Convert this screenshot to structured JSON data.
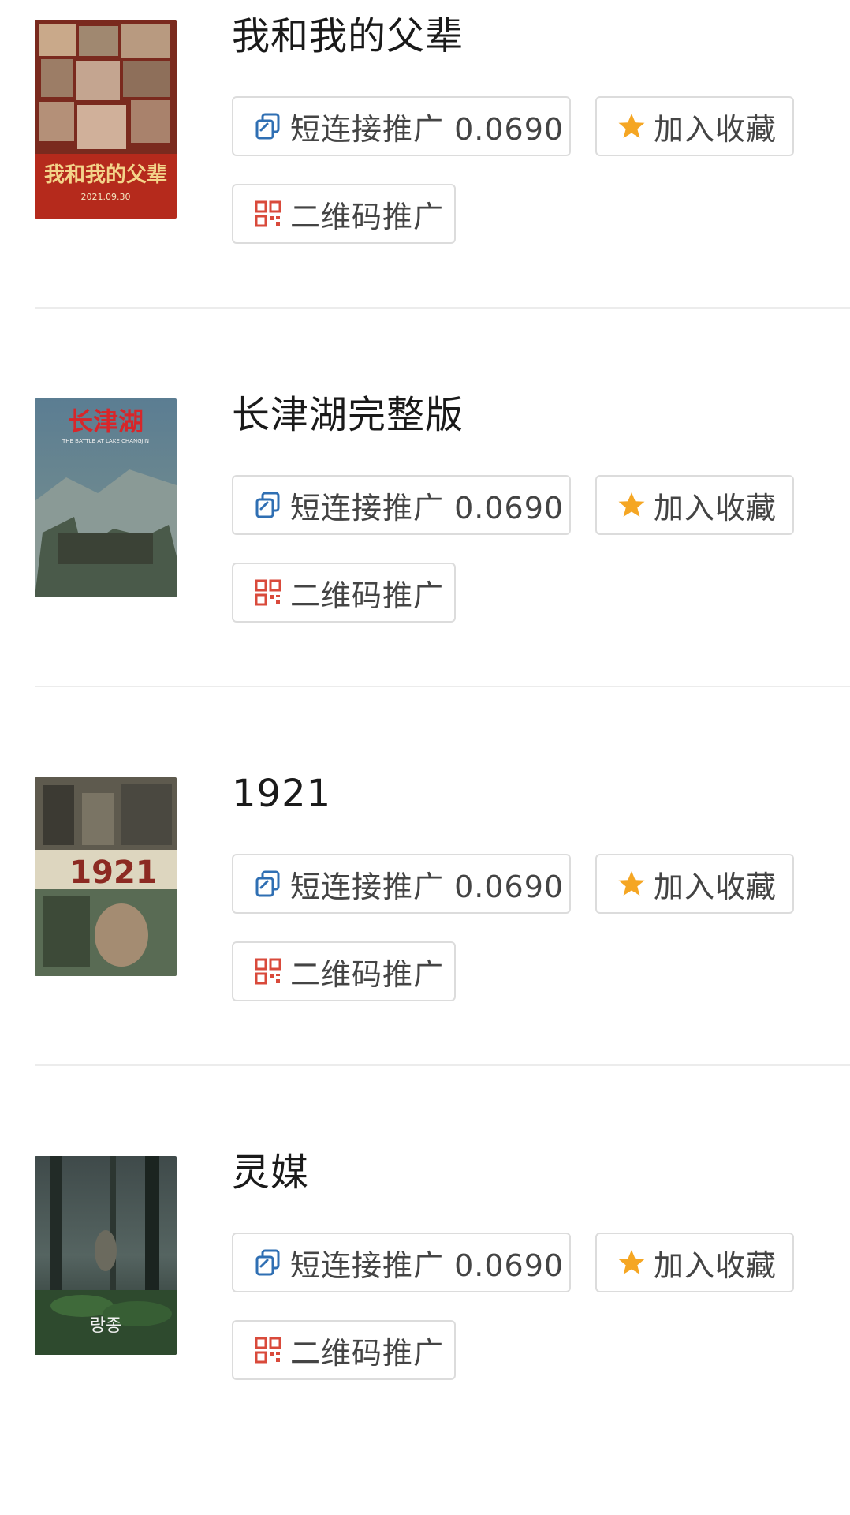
{
  "buttons": {
    "short_link_label": "短连接推广 0.0690",
    "favorite_label": "加入收藏",
    "qrcode_label": "二维码推广"
  },
  "icons": {
    "short_link": "copy-link-icon",
    "favorite": "star-icon",
    "qrcode": "qrcode-icon"
  },
  "colors": {
    "link_icon": "#2f6fb3",
    "star": "#f5a623",
    "qr_icon": "#d94a3b",
    "border": "#dcdcdc",
    "divider": "#ececec"
  },
  "items": [
    {
      "title": "我和我的父辈",
      "poster_text": "我和我的父辈",
      "poster_date": "2021.09.30"
    },
    {
      "title": "长津湖完整版",
      "poster_text": "长津湖",
      "poster_subtext": "THE BATTLE AT LAKE CHANGJIN"
    },
    {
      "title": "1921",
      "poster_text": "1921"
    },
    {
      "title": "灵媒",
      "poster_text": "랑종"
    }
  ]
}
